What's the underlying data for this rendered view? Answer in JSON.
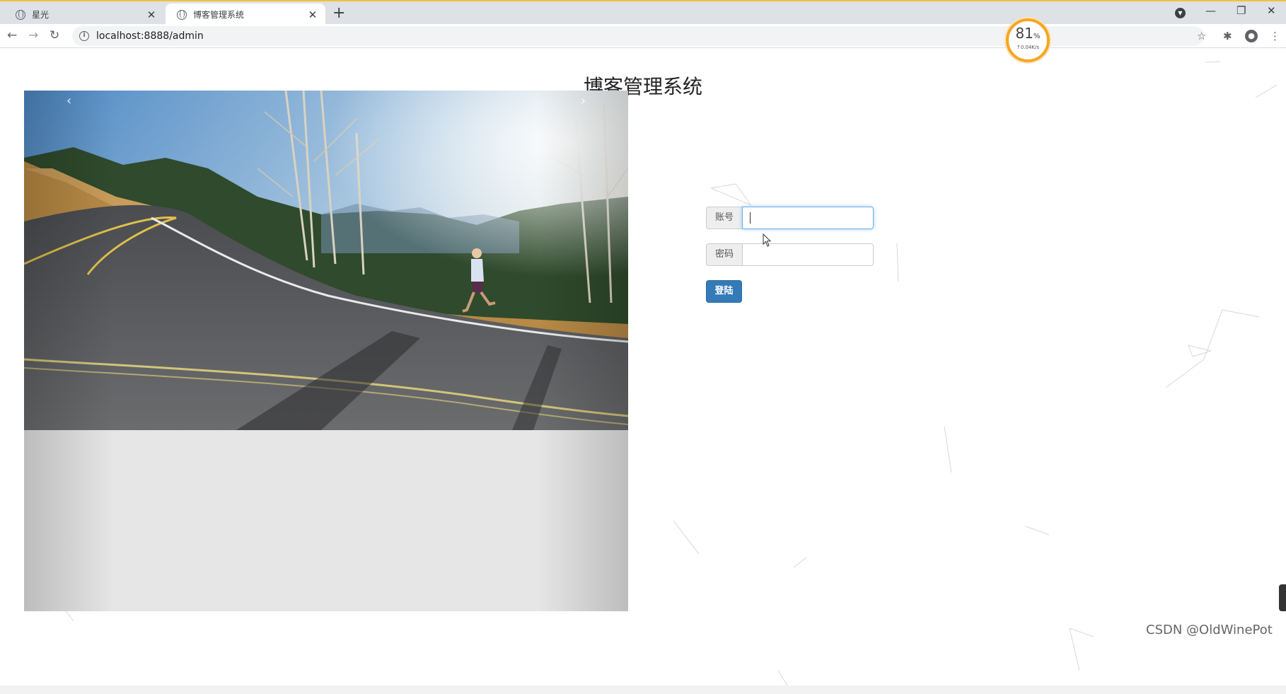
{
  "browser": {
    "tabs": [
      {
        "title": "星光",
        "active": false
      },
      {
        "title": "博客管理系统",
        "active": true
      }
    ],
    "url": "localhost:8888/admin",
    "speed_widget": {
      "percent": "81",
      "percent_unit": "%",
      "rate": "↑0.04K/s"
    }
  },
  "icons": {
    "back": "arrow-left-icon",
    "forward": "arrow-right-icon",
    "reload": "reload-icon",
    "info": "info-icon",
    "star": "star-icon",
    "extensions": "puzzle-icon",
    "profile": "profile-icon",
    "menu": "kebab-menu-icon"
  },
  "page": {
    "title": "博客管理系统",
    "carousel": {
      "prev": "‹",
      "next": "›"
    },
    "login": {
      "account_label": "账号",
      "account_value": "",
      "password_label": "密码",
      "password_value": "",
      "submit_label": "登陆"
    },
    "watermark": "CSDN @OldWinePot"
  },
  "colors": {
    "primary_button": "#337ab7",
    "focus_border": "#66afe9",
    "tab_accent": "#f0c33c"
  }
}
